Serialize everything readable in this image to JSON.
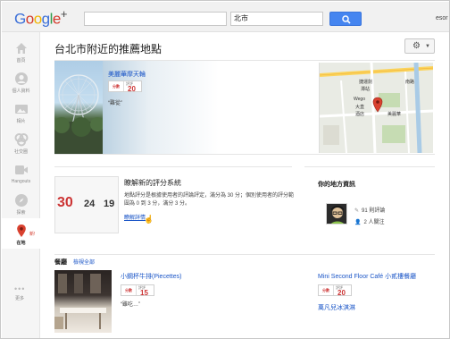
{
  "header": {
    "logo": {
      "g": "G",
      "o1": "o",
      "o2": "o",
      "g2": "g",
      "l": "l",
      "e": "e",
      "plus": "+"
    },
    "search_value": "",
    "location_value": "北市",
    "user_name": "esor"
  },
  "rail": {
    "items": [
      {
        "label": "首頁",
        "icon": "home-icon"
      },
      {
        "label": "個人資料",
        "icon": "profile-icon"
      },
      {
        "label": "相片",
        "icon": "photos-icon"
      },
      {
        "label": "社交圈",
        "icon": "circles-icon"
      },
      {
        "label": "Hangouts",
        "icon": "hangouts-icon"
      },
      {
        "label": "探索",
        "icon": "explore-icon"
      },
      {
        "label": "在地",
        "icon": "local-pin-icon",
        "badge": "新!"
      }
    ],
    "more_dots": "•••",
    "more_label": "更多"
  },
  "main": {
    "title": "台北市附近的推薦地點",
    "settings_icon": "gear-icon",
    "featured": {
      "name": "美麗華摩天輪",
      "zagat_brand": "分數",
      "zagat_label": "評評",
      "zagat_score": "20",
      "quote": "“難從”",
      "map_labels": [
        "捷運劍",
        "潭站",
        "南路",
        "Wego",
        "大直",
        "酒店",
        "美麗華"
      ]
    },
    "understand": {
      "title": "瞭解新的評分系統",
      "body": "地點評分是根據使用者的評論評定，滿分為 30 分；個別使用者的評分範圍為 0 到 3 分，滿分 3 分。",
      "link": "瞭解詳情",
      "calendar_numbers": [
        "30",
        "24",
        "19"
      ]
    },
    "local_info": {
      "title": "你的地方資訊",
      "reviews": "91 則評論",
      "followers": "2 人關注"
    },
    "restaurants": {
      "title": "餐廳",
      "view_all": "檢視全部",
      "items": [
        {
          "name": "小鋼杯牛排(Piecettes)",
          "zagat_brand": "分數",
          "zagat_label": "評評",
          "zagat_score": "15",
          "quote": "“雖吃…”"
        },
        {
          "name": "Mini Second Floor Café 小貳樓餐廳",
          "zagat_brand": "分數",
          "zagat_label": "評評",
          "zagat_score": "20"
        },
        {
          "name": "萬凡兒冰淇淋"
        }
      ]
    }
  },
  "colors": {
    "accent": "#4585f0",
    "link": "#1a55c7",
    "zagat_red": "#cc3333"
  }
}
